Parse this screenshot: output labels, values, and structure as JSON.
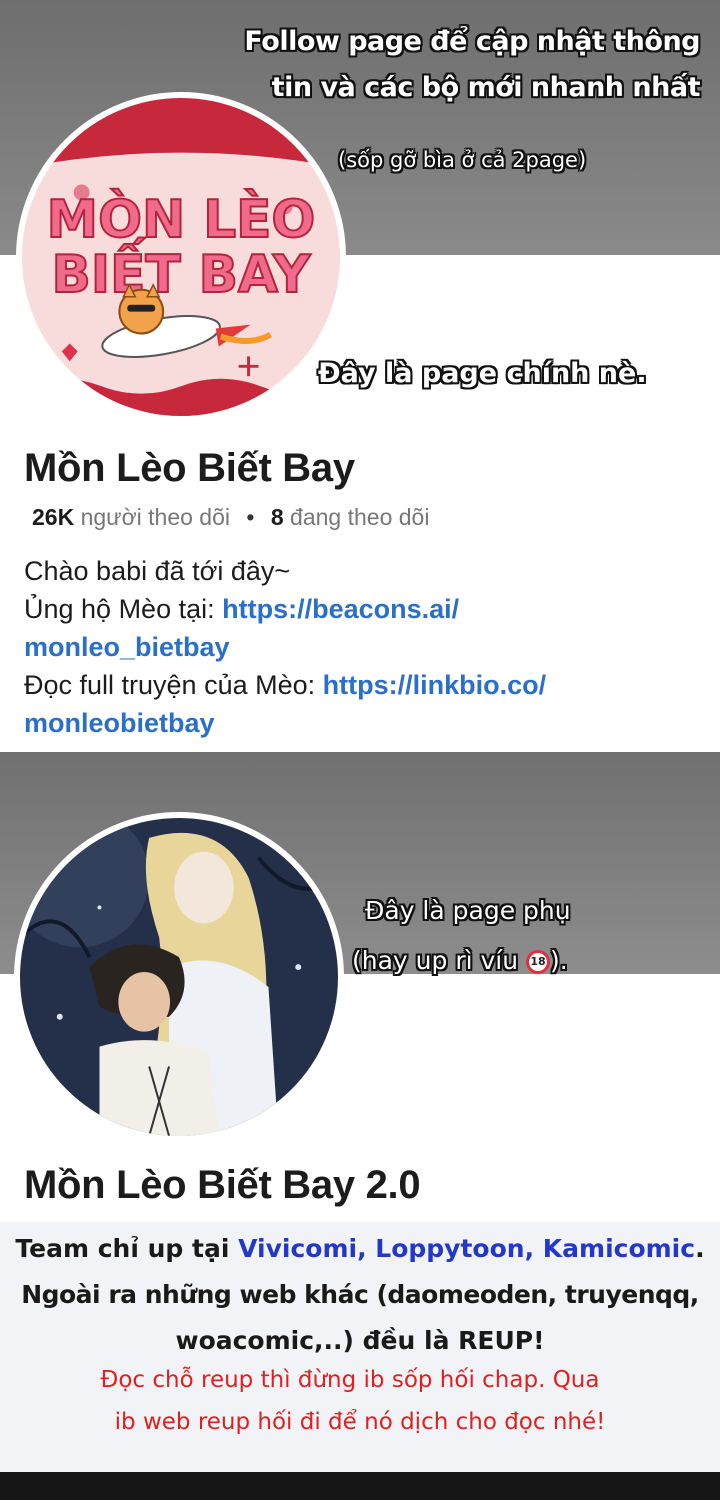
{
  "header": {
    "follow_line_1": "Follow page để cập nhật thông",
    "follow_line_2": "tin và các bộ mới nhanh nhất",
    "cover_note": "(sốp gỡ bìa ở cả 2page)"
  },
  "main_page": {
    "avatar_text_line_1": "MÒN LÈO",
    "avatar_text_line_2": "BIẾT BAY",
    "note": "Đây là page chính nè.",
    "name": "Mồn Lèo Biết Bay",
    "followers_count": "26K",
    "followers_label": "người theo dõi",
    "separator": "•",
    "following_count": "8",
    "following_label": "đang theo dõi",
    "bio": {
      "greeting": "Chào babi đã tới đây~",
      "support_label": "Ủng hộ Mèo tại: ",
      "support_link_1": "https://beacons.ai/",
      "support_link_2": "monleo_bietbay",
      "read_label": "Đọc full truyện của Mèo: ",
      "read_link_1": "https://linkbio.co/",
      "read_link_2": "monleobietbay"
    }
  },
  "sub_page": {
    "note_line_1": "Đây là page phụ",
    "note_line_2_before": "(hay up rì víu ",
    "adult_icon_text": "18",
    "note_line_2_after": ").",
    "name": "Mồn Lèo Biết Bay 2.0"
  },
  "notice": {
    "line_1_prefix": "Team chỉ up tại ",
    "line_1_sites": "Vivicomi, Loppytoon, Kamicomic",
    "line_1_suffix": ".",
    "line_2": "Ngoài ra những web khác (daomeoden, truyenqq,",
    "line_3": "woacomic,..) đều là REUP!",
    "line_4": "Đọc chỗ reup thì đừng ib sốp hối chap. Qua",
    "line_5": "ib web reup hối đi để nó dịch cho đọc nhé!"
  },
  "colors": {
    "link_blue": "#2a6fc9",
    "site_blue": "#2338c9",
    "warning_red": "#e02020",
    "band_gray": "#7a7a7a"
  },
  "icons": [
    "cat-rocket-logo",
    "anime-couple-illustration",
    "adult-18-icon"
  ]
}
